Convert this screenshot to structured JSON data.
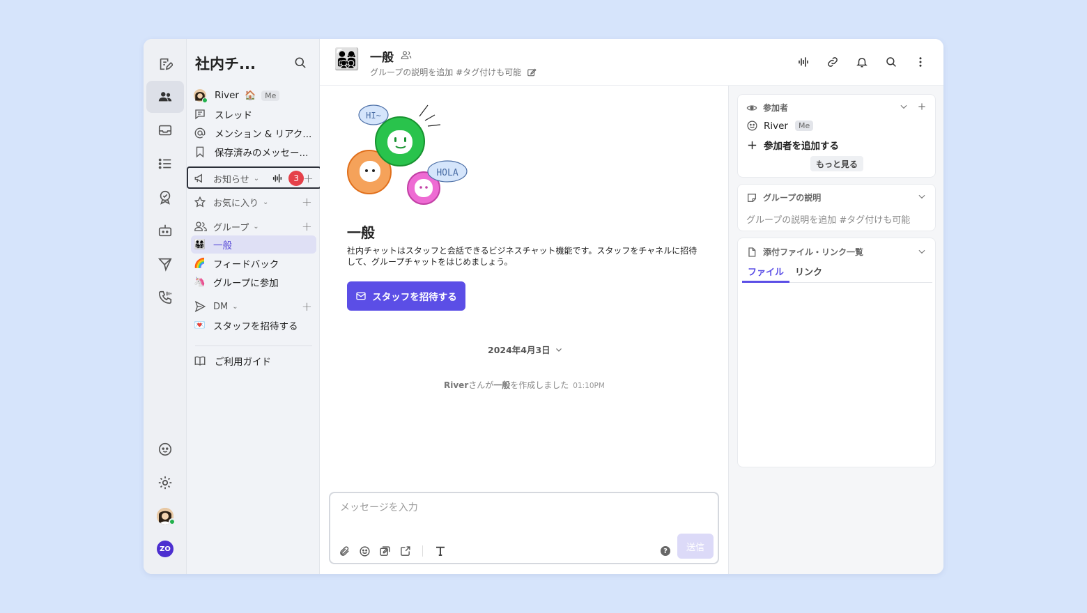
{
  "sidebar": {
    "org_name": "社内チ...",
    "me_name": "River",
    "me_house": "🏠",
    "me_tag": "Me",
    "items": [
      {
        "label": "スレッド"
      },
      {
        "label": "メンション & リアク..."
      },
      {
        "label": "保存済みのメッセー..."
      }
    ],
    "notice": {
      "label": "お知らせ",
      "badge": "3"
    },
    "favorites": {
      "label": "お気に入り"
    },
    "groups": {
      "label": "グループ",
      "items": [
        {
          "emoji": "👨‍👩‍👧‍👦",
          "label": "一般"
        },
        {
          "emoji": "🌈",
          "label": "フィードバック"
        },
        {
          "emoji": "🦄",
          "label": "グループに参加"
        }
      ]
    },
    "dm": {
      "label": "DM",
      "items": [
        {
          "emoji": "💌",
          "label": "スタッフを招待する"
        }
      ]
    },
    "guide": {
      "label": "ご利用ガイド"
    }
  },
  "rail": {
    "logo": "ZO"
  },
  "header": {
    "emoji": "👨‍👩‍👧‍👦",
    "title": "一般",
    "description": "グループの説明を追加 #タグ付けも可能"
  },
  "channel": {
    "bubble_hi": "HI~",
    "bubble_hola": "HOLA",
    "title": "一般",
    "description": "社内チャットはスタッフと会話できるビジネスチャット機能です。スタッフをチャネルに招待して、グループチャットをはじめましょう。",
    "invite_button": "スタッフを招待する"
  },
  "messages": {
    "date": "2024年4月3日",
    "system": {
      "user": "River",
      "text_a": "さんが",
      "channel": "一般",
      "text_b": "を作成しました",
      "time": "01:10PM"
    }
  },
  "composer": {
    "placeholder": "メッセージを入力",
    "send": "送信",
    "help": "?"
  },
  "right": {
    "participants": {
      "title": "参加者",
      "member": "River",
      "member_tag": "Me",
      "add": "参加者を追加する",
      "more": "もっと見る"
    },
    "group_desc": {
      "title": "グループの説明",
      "placeholder": "グループの説明を追加 #タグ付けも可能"
    },
    "attachments": {
      "title": "添付ファイル・リンク一覧",
      "tabs": [
        "ファイル",
        "リンク"
      ]
    }
  },
  "colors": {
    "accent": "#5b4ee6",
    "badge": "#e5414a",
    "background": "#d6e4fb"
  }
}
